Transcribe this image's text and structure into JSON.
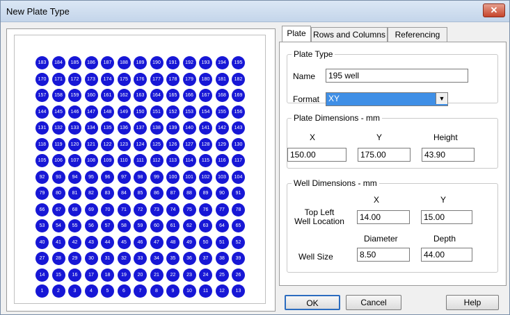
{
  "window": {
    "title": "New Plate Type",
    "close_label": "✕"
  },
  "tabs": [
    {
      "label": "Plate"
    },
    {
      "label": "Rows and Columns"
    },
    {
      "label": "Referencing"
    }
  ],
  "plate_type": {
    "legend": "Plate Type",
    "name_label": "Name",
    "name_value": "195 well",
    "format_label": "Format",
    "format_value": "XY"
  },
  "plate_dimensions": {
    "legend": "Plate Dimensions - mm",
    "x_label": "X",
    "y_label": "Y",
    "height_label": "Height",
    "x_value": "150.00",
    "y_value": "175.00",
    "height_value": "43.90"
  },
  "well_dimensions": {
    "legend": "Well Dimensions - mm",
    "x_label": "X",
    "y_label": "Y",
    "top_left_label": "Top Left\nWell Location",
    "x_value": "14.00",
    "y_value": "15.00",
    "diameter_label": "Diameter",
    "depth_label": "Depth",
    "well_size_label": "Well Size",
    "diameter_value": "8.50",
    "depth_value": "44.00"
  },
  "wells": {
    "rows": [
      [
        "183",
        "184",
        "185",
        "186",
        "187",
        "188",
        "189",
        "190",
        "191",
        "192",
        "193",
        "194",
        "195"
      ],
      [
        "170",
        "171",
        "172",
        "173",
        "174",
        "175",
        "176",
        "177",
        "178",
        "179",
        "180",
        "181",
        "182"
      ],
      [
        "157",
        "158",
        "159",
        "160",
        "161",
        "162",
        "163",
        "164",
        "165",
        "166",
        "167",
        "168",
        "169"
      ],
      [
        "144",
        "145",
        "146",
        "147",
        "148",
        "149",
        "150",
        "151",
        "152",
        "153",
        "154",
        "155",
        "156"
      ],
      [
        "131",
        "132",
        "133",
        "134",
        "135",
        "136",
        "137",
        "138",
        "139",
        "140",
        "141",
        "142",
        "143"
      ],
      [
        "118",
        "119",
        "120",
        "121",
        "122",
        "123",
        "124",
        "125",
        "126",
        "127",
        "128",
        "129",
        "130"
      ],
      [
        "105",
        "106",
        "107",
        "108",
        "109",
        "110",
        "111",
        "112",
        "113",
        "114",
        "115",
        "116",
        "117"
      ],
      [
        "92",
        "93",
        "94",
        "95",
        "96",
        "97",
        "98",
        "99",
        "100",
        "101",
        "102",
        "103",
        "104"
      ],
      [
        "79",
        "80",
        "81",
        "82",
        "83",
        "84",
        "85",
        "86",
        "87",
        "88",
        "89",
        "90",
        "91"
      ],
      [
        "66",
        "67",
        "68",
        "69",
        "70",
        "71",
        "72",
        "73",
        "74",
        "75",
        "76",
        "77",
        "78"
      ],
      [
        "53",
        "54",
        "55",
        "56",
        "57",
        "58",
        "59",
        "60",
        "61",
        "62",
        "63",
        "64",
        "65"
      ],
      [
        "40",
        "41",
        "42",
        "43",
        "44",
        "45",
        "46",
        "47",
        "48",
        "49",
        "50",
        "51",
        "52"
      ],
      [
        "27",
        "28",
        "29",
        "30",
        "31",
        "32",
        "33",
        "34",
        "35",
        "36",
        "37",
        "38",
        "39"
      ],
      [
        "14",
        "15",
        "16",
        "17",
        "18",
        "19",
        "20",
        "21",
        "22",
        "23",
        "24",
        "25",
        "26"
      ],
      [
        "1",
        "2",
        "3",
        "4",
        "5",
        "6",
        "7",
        "8",
        "9",
        "10",
        "11",
        "12",
        "13"
      ]
    ],
    "color": "#1717d6"
  },
  "buttons": {
    "ok": "OK",
    "cancel": "Cancel",
    "help": "Help"
  }
}
